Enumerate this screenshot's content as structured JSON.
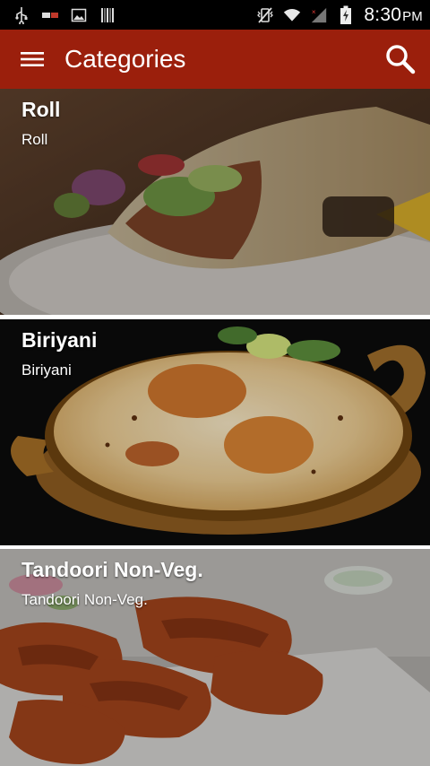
{
  "status_bar": {
    "time": "8:30",
    "ampm": "PM",
    "icons": [
      "usb-icon",
      "notification-icon",
      "image-icon",
      "barcode-icon",
      "vibrate-icon",
      "wifi-icon",
      "signal-icon",
      "battery-icon"
    ]
  },
  "app_bar": {
    "title": "Categories",
    "background_color": "#9b1f0c",
    "menu_icon": "hamburger-menu-icon",
    "search_icon": "search-icon"
  },
  "categories": [
    {
      "title": "Roll",
      "subtitle": "Roll",
      "image": "roll-wrap-photo"
    },
    {
      "title": "Biriyani",
      "subtitle": "Biriyani",
      "image": "biriyani-photo"
    },
    {
      "title": "Tandoori Non-Veg.",
      "subtitle": "Tandoori Non-Veg.",
      "image": "tandoori-chicken-photo"
    }
  ]
}
